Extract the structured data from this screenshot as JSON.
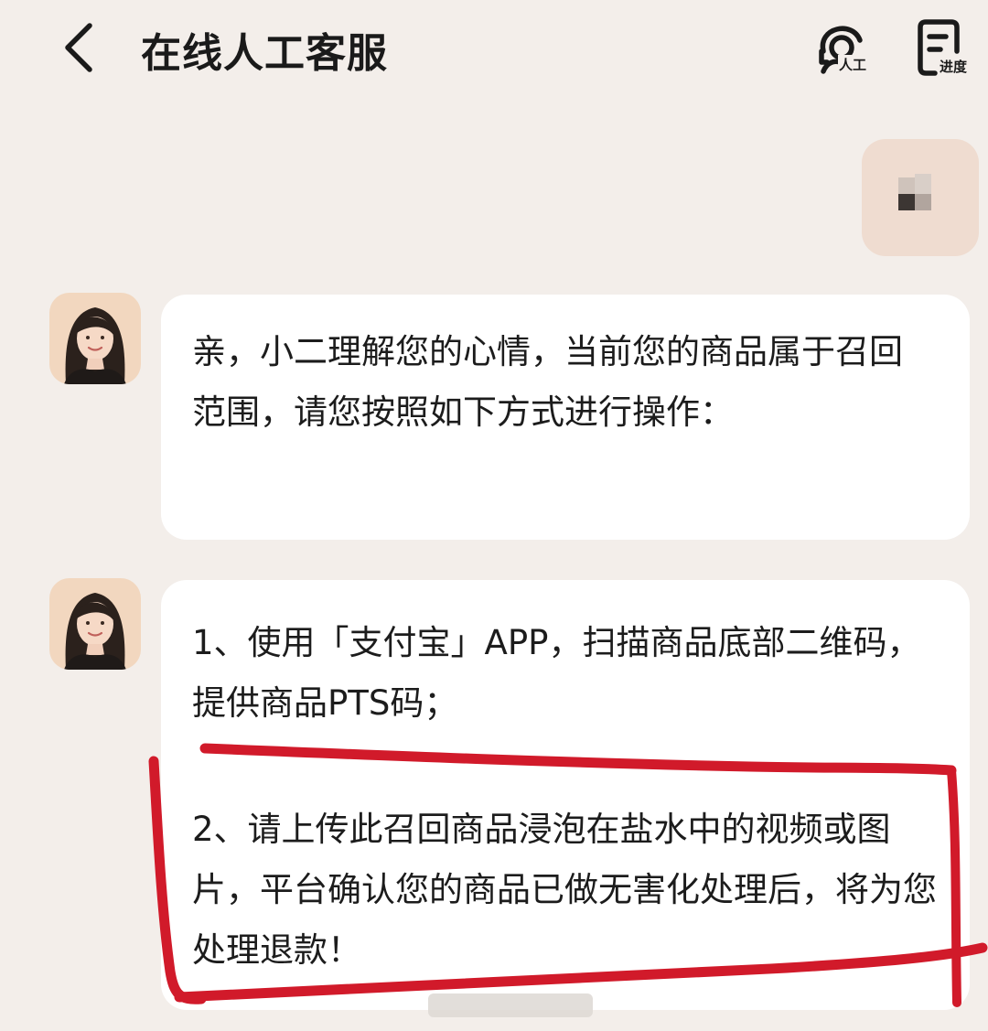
{
  "header": {
    "title": "在线人工客服",
    "agent_label": "人工",
    "progress_label": "进度"
  },
  "messages": {
    "agent_1": "亲，小二理解您的心情，当前您的商品属于召回范围，请您按照如下方式进行操作：",
    "agent_2_line_1": "1、使用「支付宝」APP，扫描商品底部二维码，提供商品PTS码；",
    "agent_2_line_2": "2、请上传此召回商品浸泡在盐水中的视频或图片，平台确认您的商品已做无害化处理后，将为您处理退款！"
  },
  "colors": {
    "background": "#f3eeea",
    "bubble": "#ffffff",
    "user_bubble": "#efdcd0",
    "annotation": "#d11a2a"
  },
  "icons": [
    "back-arrow-icon",
    "agent-headset-icon",
    "progress-document-icon"
  ]
}
